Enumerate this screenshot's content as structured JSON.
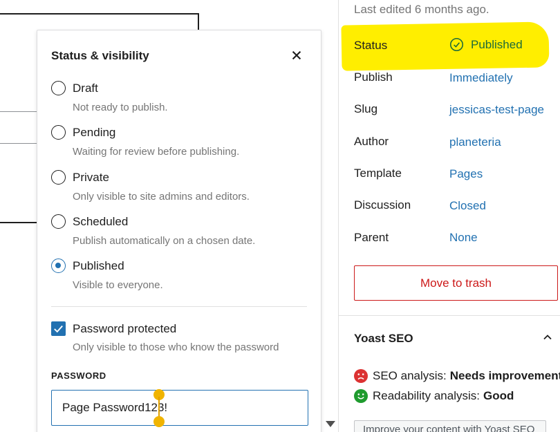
{
  "popover": {
    "title": "Status & visibility",
    "options": [
      {
        "label": "Draft",
        "help": "Not ready to publish.",
        "checked": false
      },
      {
        "label": "Pending",
        "help": "Waiting for review before publishing.",
        "checked": false
      },
      {
        "label": "Private",
        "help": "Only visible to site admins and editors.",
        "checked": false
      },
      {
        "label": "Scheduled",
        "help": "Publish automatically on a chosen date.",
        "checked": false
      },
      {
        "label": "Published",
        "help": "Visible to everyone.",
        "checked": true
      }
    ],
    "password_protected": {
      "label": "Password protected",
      "help": "Only visible to those who know the password",
      "checked": true
    },
    "password_label": "PASSWORD",
    "password_value": "Page Password123!"
  },
  "sidebar": {
    "last_edited": "Last edited 6 months ago.",
    "rows": [
      {
        "label": "Status",
        "value": "Published"
      },
      {
        "label": "Publish",
        "value": "Immediately"
      },
      {
        "label": "Slug",
        "value": "jessicas-test-page"
      },
      {
        "label": "Author",
        "value": "planeteria"
      },
      {
        "label": "Template",
        "value": "Pages"
      },
      {
        "label": "Discussion",
        "value": "Closed"
      },
      {
        "label": "Parent",
        "value": "None"
      }
    ],
    "trash_label": "Move to trash",
    "yoast": {
      "title": "Yoast SEO",
      "seo_label": "SEO analysis:",
      "seo_value": "Needs improvement",
      "readability_label": "Readability analysis:",
      "readability_value": "Good",
      "button_label": "Improve your content with Yoast SEO"
    }
  },
  "colors": {
    "accent": "#2271b1",
    "danger": "#cc1818",
    "highlight": "#ffee00",
    "success": "#1d6b3a"
  }
}
